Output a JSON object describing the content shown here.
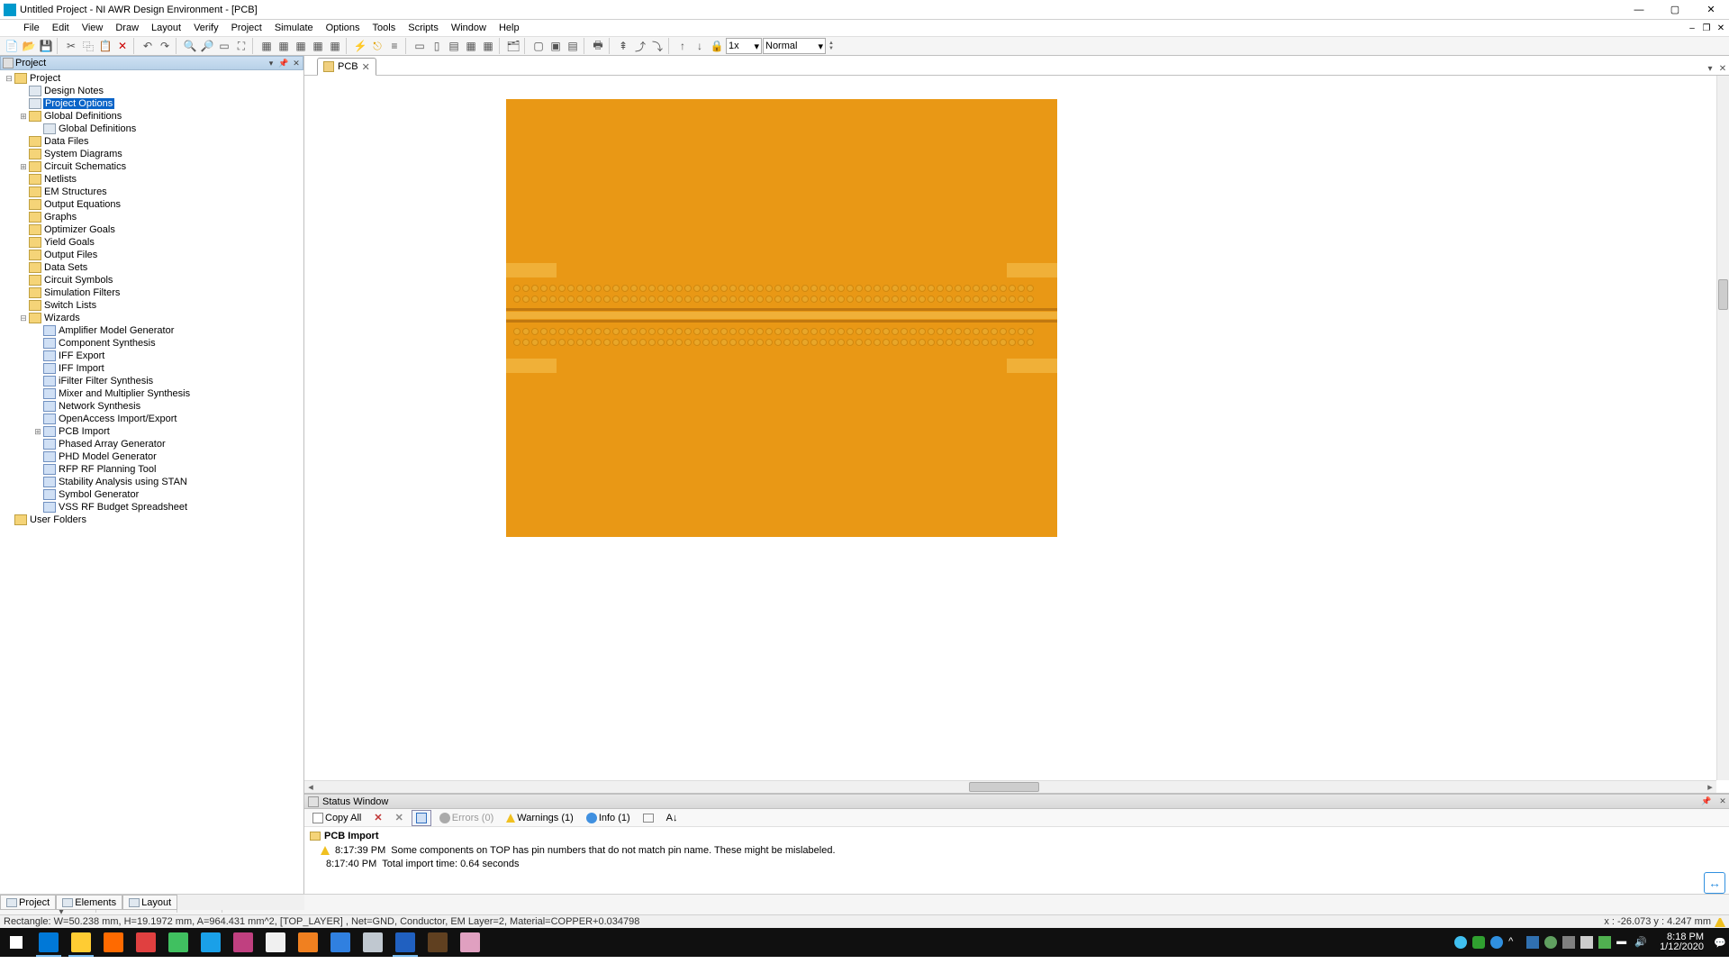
{
  "title": "Untitled Project - NI AWR Design Environment - [PCB]",
  "menus": [
    "File",
    "Edit",
    "View",
    "Draw",
    "Layout",
    "Verify",
    "Project",
    "Simulate",
    "Options",
    "Tools",
    "Scripts",
    "Window",
    "Help"
  ],
  "zoom": "1x",
  "zoom_mode": "Normal",
  "project_panel_title": "Project",
  "tree": [
    {
      "d": 0,
      "exp": "-",
      "ico": "ico-folder",
      "t": "Project"
    },
    {
      "d": 1,
      "exp": "",
      "ico": "ico-file",
      "t": "Design Notes"
    },
    {
      "d": 1,
      "exp": "",
      "ico": "ico-file",
      "t": "Project Options",
      "sel": true
    },
    {
      "d": 1,
      "exp": "+",
      "ico": "ico-folder",
      "t": "Global Definitions"
    },
    {
      "d": 2,
      "exp": "",
      "ico": "ico-file",
      "t": "Global Definitions"
    },
    {
      "d": 1,
      "exp": "",
      "ico": "ico-folder",
      "t": "Data Files"
    },
    {
      "d": 1,
      "exp": "",
      "ico": "ico-folder",
      "t": "System Diagrams"
    },
    {
      "d": 1,
      "exp": "+",
      "ico": "ico-folder",
      "t": "Circuit Schematics"
    },
    {
      "d": 1,
      "exp": "",
      "ico": "ico-folder",
      "t": "Netlists"
    },
    {
      "d": 1,
      "exp": "",
      "ico": "ico-folder",
      "t": "EM Structures"
    },
    {
      "d": 1,
      "exp": "",
      "ico": "ico-folder",
      "t": "Output Equations"
    },
    {
      "d": 1,
      "exp": "",
      "ico": "ico-folder",
      "t": "Graphs"
    },
    {
      "d": 1,
      "exp": "",
      "ico": "ico-folder",
      "t": "Optimizer Goals"
    },
    {
      "d": 1,
      "exp": "",
      "ico": "ico-folder",
      "t": "Yield Goals"
    },
    {
      "d": 1,
      "exp": "",
      "ico": "ico-folder",
      "t": "Output Files"
    },
    {
      "d": 1,
      "exp": "",
      "ico": "ico-folder",
      "t": "Data Sets"
    },
    {
      "d": 1,
      "exp": "",
      "ico": "ico-folder",
      "t": "Circuit Symbols"
    },
    {
      "d": 1,
      "exp": "",
      "ico": "ico-folder",
      "t": "Simulation Filters"
    },
    {
      "d": 1,
      "exp": "",
      "ico": "ico-folder",
      "t": "Switch Lists"
    },
    {
      "d": 1,
      "exp": "-",
      "ico": "ico-folder",
      "t": "Wizards"
    },
    {
      "d": 2,
      "exp": "",
      "ico": "ico-wizard",
      "t": "Amplifier Model Generator"
    },
    {
      "d": 2,
      "exp": "",
      "ico": "ico-wizard",
      "t": "Component Synthesis"
    },
    {
      "d": 2,
      "exp": "",
      "ico": "ico-wizard",
      "t": "IFF Export"
    },
    {
      "d": 2,
      "exp": "",
      "ico": "ico-wizard",
      "t": "IFF Import"
    },
    {
      "d": 2,
      "exp": "",
      "ico": "ico-wizard",
      "t": "iFilter Filter Synthesis"
    },
    {
      "d": 2,
      "exp": "",
      "ico": "ico-wizard",
      "t": "Mixer and Multiplier Synthesis"
    },
    {
      "d": 2,
      "exp": "",
      "ico": "ico-wizard",
      "t": "Network Synthesis"
    },
    {
      "d": 2,
      "exp": "",
      "ico": "ico-wizard",
      "t": "OpenAccess Import/Export"
    },
    {
      "d": 2,
      "exp": "+",
      "ico": "ico-wizard",
      "t": "PCB Import"
    },
    {
      "d": 2,
      "exp": "",
      "ico": "ico-wizard",
      "t": "Phased Array Generator"
    },
    {
      "d": 2,
      "exp": "",
      "ico": "ico-wizard",
      "t": "PHD Model Generator"
    },
    {
      "d": 2,
      "exp": "",
      "ico": "ico-wizard",
      "t": "RFP RF Planning Tool"
    },
    {
      "d": 2,
      "exp": "",
      "ico": "ico-wizard",
      "t": "Stability Analysis using STAN"
    },
    {
      "d": 2,
      "exp": "",
      "ico": "ico-wizard",
      "t": "Symbol Generator"
    },
    {
      "d": 2,
      "exp": "",
      "ico": "ico-wizard",
      "t": "VSS RF Budget Spreadsheet"
    },
    {
      "d": 0,
      "exp": "",
      "ico": "ico-folder",
      "t": "User Folders"
    }
  ],
  "left_tabs": [
    "Project",
    "Elements",
    "Layout"
  ],
  "doc_tab": "PCB",
  "status_title": "Status Window",
  "status_tb": {
    "copy": "Copy All",
    "errors": "Errors (0)",
    "warnings": "Warnings (1)",
    "info": "Info (1)"
  },
  "status_header": "PCB Import",
  "status_msgs": [
    {
      "type": "warn",
      "time": "8:17:39 PM",
      "text": "Some components on TOP has pin numbers that do not match pin name. These might be mislabeled."
    },
    {
      "type": "info",
      "time": "8:17:40 PM",
      "text": "Total import time: 0.64 seconds"
    }
  ],
  "statusbar_left": "Rectangle: W=50.238 mm, H=19.1972 mm, A=964.431 mm^2, [TOP_LAYER] , Net=GND, Conductor, EM Layer=2, Material=COPPER+0.034798",
  "statusbar_xy": "x :   -26.073    y :    4.247   mm",
  "clock_time": "8:18 PM",
  "clock_date": "1/12/2020",
  "taskbar_apps": [
    {
      "c": "#0078d7",
      "a": true
    },
    {
      "c": "#ffcc33",
      "a": true
    },
    {
      "c": "#ff6a00",
      "a": false
    },
    {
      "c": "#e04040",
      "a": false
    },
    {
      "c": "#40c060",
      "a": false
    },
    {
      "c": "#1aa0e8",
      "a": false
    },
    {
      "c": "#c04080",
      "a": false
    },
    {
      "c": "#f0f0f0",
      "a": false
    },
    {
      "c": "#f08020",
      "a": false
    },
    {
      "c": "#3080e0",
      "a": false
    },
    {
      "c": "#c0c8d0",
      "a": false
    },
    {
      "c": "#2060c0",
      "a": true
    },
    {
      "c": "#604020",
      "a": false
    },
    {
      "c": "#e0a0c0",
      "a": false
    }
  ]
}
